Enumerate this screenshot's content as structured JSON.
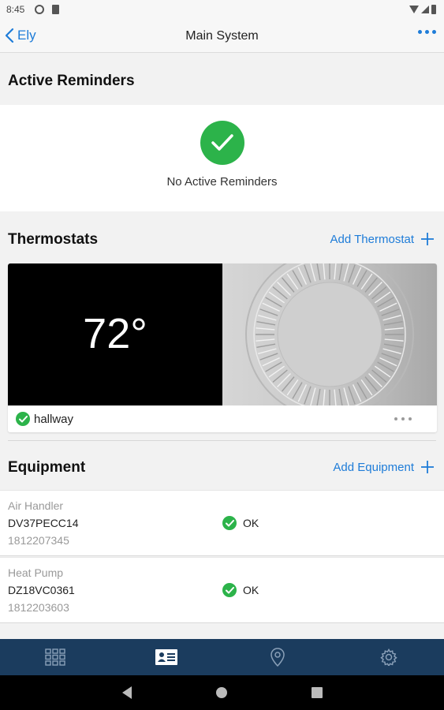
{
  "status_bar": {
    "time": "8:45"
  },
  "nav": {
    "back_label": "Ely",
    "title": "Main System"
  },
  "reminders": {
    "title": "Active Reminders",
    "empty_text": "No Active Reminders"
  },
  "thermostats": {
    "title": "Thermostats",
    "add_label": "Add Thermostat",
    "items": [
      {
        "temperature": "72°",
        "name": "hallway",
        "status": "ok"
      }
    ]
  },
  "equipment": {
    "title": "Equipment",
    "add_label": "Add Equipment",
    "items": [
      {
        "type": "Air Handler",
        "model": "DV37PECC14",
        "serial": "1812207345",
        "status": "OK"
      },
      {
        "type": "Heat Pump",
        "model": "DZ18VC0361",
        "serial": "1812203603",
        "status": "OK"
      }
    ]
  },
  "tabs": [
    {
      "icon": "grid-icon",
      "active": false
    },
    {
      "icon": "id-card-icon",
      "active": true
    },
    {
      "icon": "location-pin-icon",
      "active": false
    },
    {
      "icon": "gear-icon",
      "active": false
    }
  ],
  "colors": {
    "accent": "#1e7cd8",
    "success": "#2cb34a",
    "tabbar": "#1b3c5e"
  }
}
